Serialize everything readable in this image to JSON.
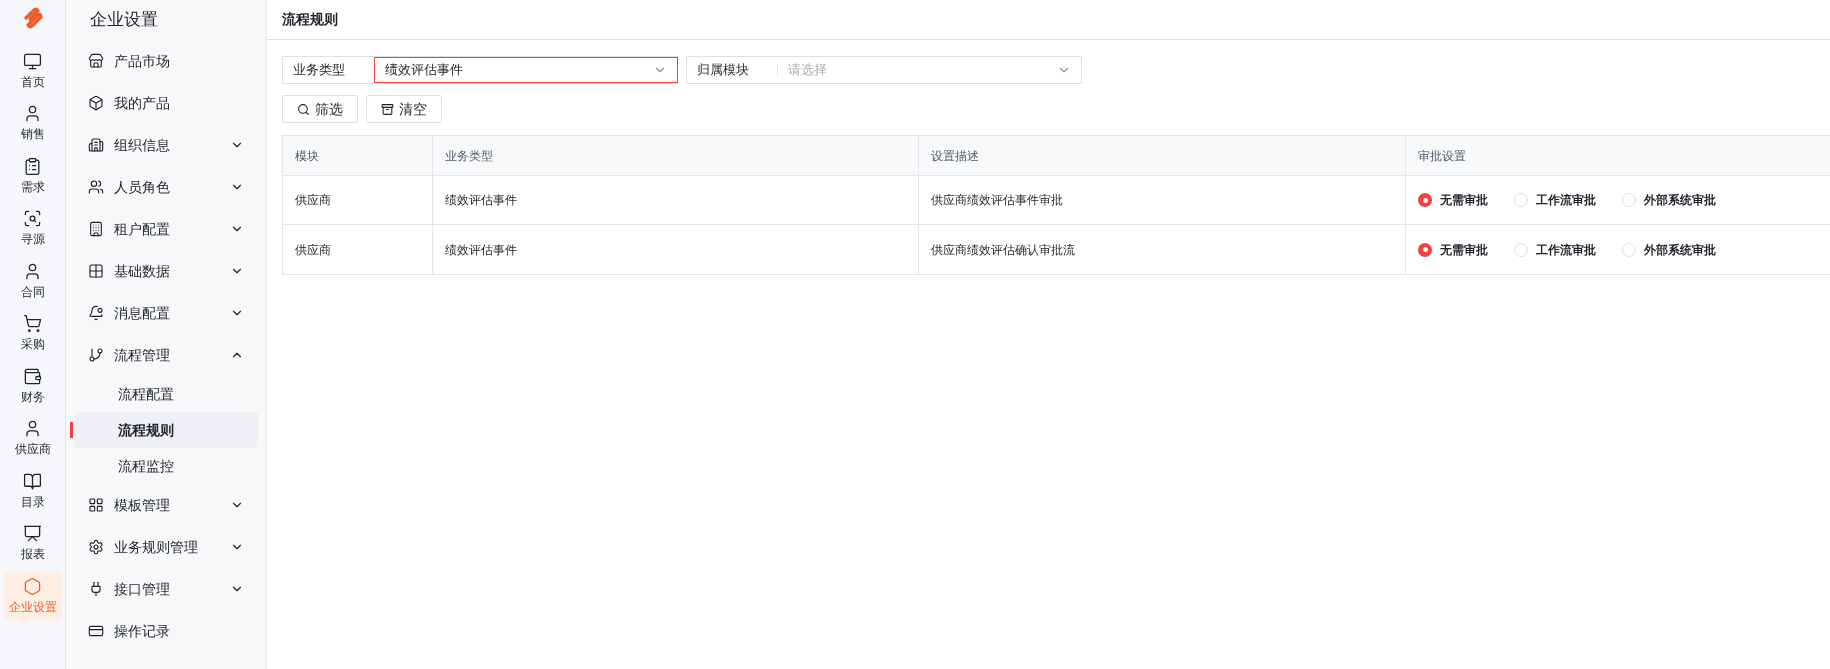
{
  "rail": {
    "items": [
      {
        "label": "首页",
        "selected": false
      },
      {
        "label": "销售",
        "selected": false
      },
      {
        "label": "需求",
        "selected": false
      },
      {
        "label": "寻源",
        "selected": false
      },
      {
        "label": "合同",
        "selected": false
      },
      {
        "label": "采购",
        "selected": false
      },
      {
        "label": "财务",
        "selected": false
      },
      {
        "label": "供应商",
        "selected": false
      },
      {
        "label": "目录",
        "selected": false
      },
      {
        "label": "报表",
        "selected": false
      },
      {
        "label": "企业设置",
        "selected": true
      }
    ]
  },
  "sidebar": {
    "title": "企业设置",
    "items": [
      {
        "label": "产品市场"
      },
      {
        "label": "我的产品"
      },
      {
        "label": "组织信息",
        "expanded": false
      },
      {
        "label": "人员角色",
        "expanded": false
      },
      {
        "label": "租户配置",
        "expanded": false
      },
      {
        "label": "基础数据",
        "expanded": false
      },
      {
        "label": "消息配置",
        "expanded": false
      },
      {
        "label": "流程管理",
        "expanded": true,
        "children": [
          {
            "label": "流程配置",
            "selected": false
          },
          {
            "label": "流程规则",
            "selected": true
          },
          {
            "label": "流程监控",
            "selected": false
          }
        ]
      },
      {
        "label": "模板管理",
        "expanded": false
      },
      {
        "label": "业务规则管理",
        "expanded": false
      },
      {
        "label": "接口管理",
        "expanded": false
      },
      {
        "label": "操作记录"
      }
    ]
  },
  "page_title": "流程规则",
  "filters": [
    {
      "label": "业务类型",
      "value": "绩效评估事件",
      "focused": true
    },
    {
      "label": "归属模块",
      "placeholder": "请选择",
      "focused": false
    }
  ],
  "buttons": [
    {
      "label": "筛选",
      "kind": "search"
    },
    {
      "label": "清空",
      "kind": "clear"
    }
  ],
  "table": {
    "columns": [
      "模块",
      "业务类型",
      "设置描述",
      "审批设置"
    ],
    "rows": [
      {
        "module": "供应商",
        "type": "绩效评估事件",
        "description": "供应商绩效评估事件审批",
        "options": [
          {
            "label": "无需审批",
            "selected": true
          },
          {
            "label": "工作流审批",
            "selected": false
          },
          {
            "label": "外部系统审批",
            "selected": false
          }
        ]
      },
      {
        "module": "供应商",
        "type": "绩效评估事件",
        "description": "供应商绩效评估确认审批流",
        "options": [
          {
            "label": "无需审批",
            "selected": true
          },
          {
            "label": "工作流审批",
            "selected": false
          },
          {
            "label": "外部系统审批",
            "selected": false
          }
        ]
      }
    ]
  }
}
